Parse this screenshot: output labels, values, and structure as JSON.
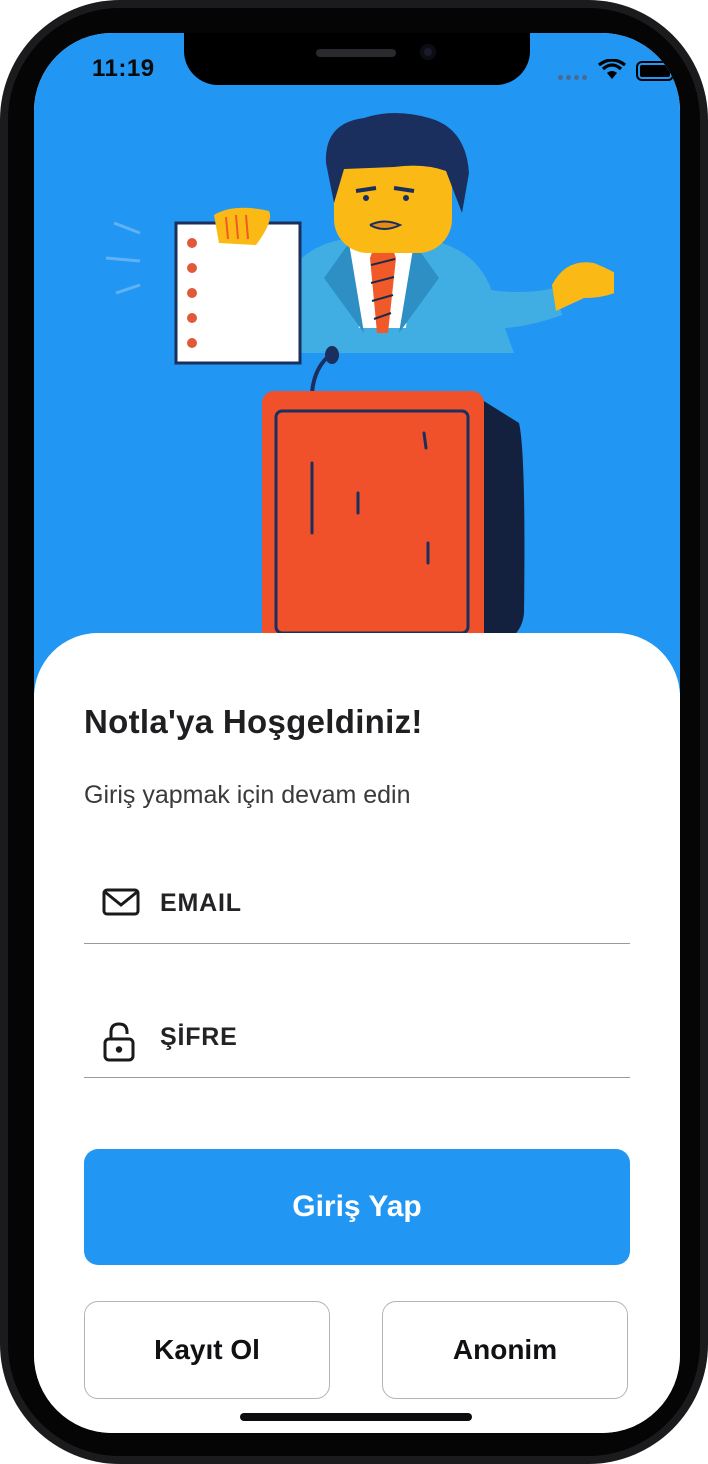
{
  "status_bar": {
    "time": "11:19",
    "wifi_icon": "wifi-icon",
    "battery_icon": "battery-icon"
  },
  "hero": {
    "background_color": "#2196f3",
    "illustration": "speaker-at-podium-illustration"
  },
  "login": {
    "title": "Notla'ya Hoşgeldiniz!",
    "subtitle": "Giriş yapmak için devam edin",
    "email_label": "EMAIL",
    "email_icon": "mail-icon",
    "password_label": "ŞİFRE",
    "password_icon": "lock-icon",
    "login_button": "Giriş Yap",
    "register_button": "Kayıt Ol",
    "anonymous_button": "Anonim"
  },
  "colors": {
    "accent": "#2196f3",
    "text_dark": "#1f1f22",
    "background": "#ffffff"
  }
}
